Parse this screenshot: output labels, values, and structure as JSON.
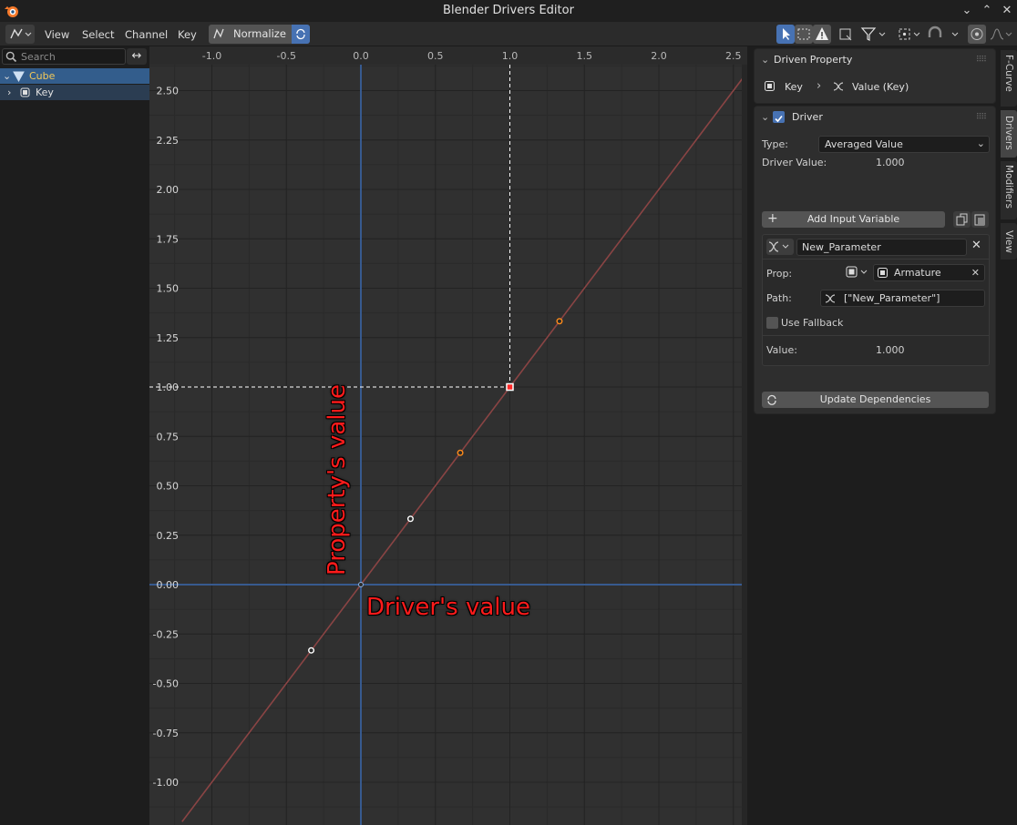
{
  "window": {
    "title": "Blender Drivers Editor"
  },
  "header": {
    "menus": [
      "View",
      "Select",
      "Channel",
      "Key"
    ],
    "normalize_label": "Normalize"
  },
  "channels": {
    "search_placeholder": "Search",
    "items": [
      {
        "label": "Cube",
        "expanded": true,
        "selected": true
      },
      {
        "label": "Key",
        "expanded": false
      }
    ]
  },
  "graph": {
    "x_ticks": [
      "-1.0",
      "-0.5",
      "0.0",
      "0.5",
      "1.0",
      "1.5",
      "2.0",
      "2.5"
    ],
    "y_ticks": [
      "2.50",
      "2.25",
      "2.00",
      "1.75",
      "1.50",
      "1.25",
      "1.00",
      "0.75",
      "0.50",
      "0.25",
      "0.00",
      "-0.25",
      "-0.50",
      "-0.75",
      "-1.00"
    ],
    "curve_color": "#8a4444",
    "keyframes": [
      {
        "x": -0.333,
        "y": -0.333,
        "state": "white"
      },
      {
        "x": 0.0,
        "y": 0.0,
        "state": "handle"
      },
      {
        "x": 0.333,
        "y": 0.333,
        "state": "white"
      },
      {
        "x": 0.667,
        "y": 0.667,
        "state": "orange"
      },
      {
        "x": 1.0,
        "y": 1.0,
        "state": "active"
      },
      {
        "x": 1.333,
        "y": 1.333,
        "state": "orange"
      }
    ],
    "cursor": {
      "x": 1.0,
      "y": 1.0
    },
    "annotations": {
      "vertical": "Property's value",
      "horizontal": "Driver's value"
    }
  },
  "sidebar": {
    "driven_property": {
      "title": "Driven Property",
      "object": "Key",
      "property": "Value (Key)"
    },
    "driver": {
      "title": "Driver",
      "enabled": true,
      "type_label": "Type:",
      "type_value": "Averaged Value",
      "driver_value_label": "Driver Value:",
      "driver_value": "1.000",
      "add_variable": "Add Input Variable",
      "variable": {
        "name": "New_Parameter",
        "prop_label": "Prop:",
        "prop_object": "Armature",
        "path_label": "Path:",
        "path_value": "[\"New_Parameter\"]",
        "fallback_label": "Use Fallback",
        "value_label": "Value:",
        "value": "1.000"
      },
      "update_dependencies": "Update Dependencies"
    }
  },
  "tabs": [
    "F-Curve",
    "Drivers",
    "Modifiers",
    "View"
  ]
}
